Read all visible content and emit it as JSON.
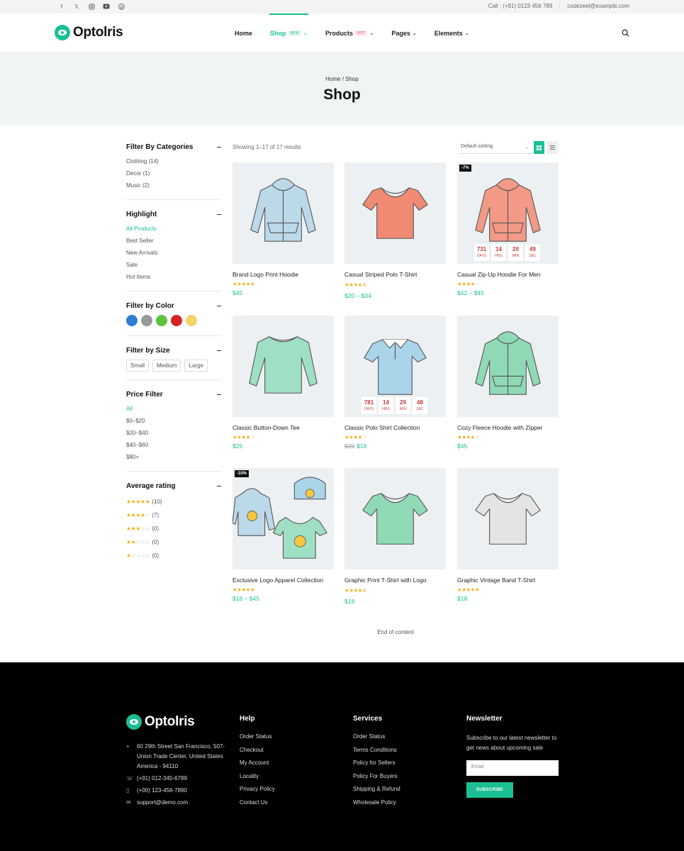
{
  "topbar": {
    "social_icons": [
      "facebook-icon",
      "x-icon",
      "instagram-icon",
      "youtube-icon",
      "pinterest-icon"
    ],
    "phone": "Call : (+91) 0123 456 789",
    "email": "codezeel@example.com"
  },
  "header": {
    "logo": "Optolris",
    "nav": [
      {
        "label": "Home"
      },
      {
        "label": "Shop",
        "badge": "NEW"
      },
      {
        "label": "Products",
        "badge": "HOT"
      },
      {
        "label": "Pages"
      },
      {
        "label": "Elements"
      }
    ]
  },
  "page_head": {
    "breadcrumb": "Home / Shop",
    "title": "Shop"
  },
  "sidebar": {
    "categories": {
      "title": "Filter By Categories",
      "items": [
        "Clothing (14)",
        "Decor (1)",
        "Music (2)"
      ]
    },
    "highlight": {
      "title": "Highlight",
      "items": [
        "All Products",
        "Best Seller",
        "New Arrivals",
        "Sale",
        "Hot Items"
      ]
    },
    "color": {
      "title": "Filter by Color",
      "swatches": [
        "#2d7dd2",
        "#999999",
        "#5cc33b",
        "#d62424",
        "#f5d36b"
      ]
    },
    "size": {
      "title": "Filter by Size",
      "items": [
        "Small",
        "Medium",
        "Large"
      ]
    },
    "price": {
      "title": "Price Filter",
      "items": [
        "All",
        "$0–$20",
        "$20–$40",
        "$40–$60",
        "$80+"
      ]
    },
    "rating": {
      "title": "Average rating",
      "rows": [
        {
          "stars": 5,
          "count": "(10)"
        },
        {
          "stars": 4,
          "count": "(7)"
        },
        {
          "stars": 3,
          "count": "(0)"
        },
        {
          "stars": 2,
          "count": "(0)"
        },
        {
          "stars": 1,
          "count": "(0)"
        }
      ]
    }
  },
  "toolbar": {
    "results": "Showing 1–17 of 17 results",
    "sort": "Default sorting"
  },
  "products": [
    {
      "name": "Brand Logo Print Hoodie",
      "rating": 5,
      "price": "$45",
      "image": "hoodie",
      "color": "#bcd9ea"
    },
    {
      "name": "Casual Striped Polo T-Shirt",
      "rating": 4.5,
      "price": "$20 – $34",
      "image": "tshirt",
      "color": "#f08a72"
    },
    {
      "name": "Casual Zip-Up Hoodie For Men",
      "rating": 4,
      "price": "$42 – $45",
      "image": "hoodie",
      "color": "#f29a86",
      "badge": "-7%",
      "countdown": [
        {
          "n": "731",
          "u": "DAYS"
        },
        {
          "n": "14",
          "u": "HRS"
        },
        {
          "n": "29",
          "u": "MIN"
        },
        {
          "n": "49",
          "u": "SEC"
        }
      ]
    },
    {
      "name": "Classic Button-Down Tee",
      "rating": 4,
      "price": "$25",
      "image": "longsleeve",
      "color": "#9fe0c4"
    },
    {
      "name": "Classic Polo Shirt Collection",
      "rating": 4,
      "old_price": "$20",
      "price": "$18",
      "image": "polo",
      "color": "#a9d4ea",
      "countdown": [
        {
          "n": "781",
          "u": "DAYS"
        },
        {
          "n": "14",
          "u": "HRS"
        },
        {
          "n": "29",
          "u": "MIN"
        },
        {
          "n": "48",
          "u": "SEC"
        }
      ]
    },
    {
      "name": "Cozy Fleece Hoodie with Zipper",
      "rating": 4,
      "price": "$45",
      "image": "hoodie",
      "color": "#8fdab5"
    },
    {
      "name": "Exclusive Logo Apparel Collection",
      "rating": 5,
      "price": "$18 – $45",
      "image": "collection",
      "color": "#bcd9ea",
      "badge": "-10%"
    },
    {
      "name": "Graphic Print T-Shirt with Logo",
      "rating": 4.5,
      "price": "$18",
      "image": "tshirt",
      "color": "#8fdab5"
    },
    {
      "name": "Graphic Vintage Band T-Shirt",
      "rating": 5,
      "price": "$18",
      "image": "tshirt",
      "color": "#e4e4e4"
    }
  ],
  "end_note": "End of content",
  "footer": {
    "logo": "Optolris",
    "address": "60 29th Street San Francisco, 507-Union Trade Center, United States America - 94110",
    "phone1": "(+91) 012-345-6789",
    "phone2": "(+00) 123-456-7890",
    "email": "support@demo.com",
    "help": {
      "title": "Help",
      "links": [
        "Order Status",
        "Checkout",
        "My Account",
        "Locality",
        "Privacy Policy",
        "Contact Us"
      ]
    },
    "services": {
      "title": "Services",
      "links": [
        "Order Status",
        "Terms Conditions",
        "Policy for Sellers",
        "Policy For Buyers",
        "Shipping & Refund",
        "Wholesale Policy"
      ]
    },
    "newsletter": {
      "title": "Newsletter",
      "text": "Subscribe to our latest newsletter to get news about upcoming sale",
      "placeholder": "Email",
      "button": "SUBSCRIBE"
    }
  }
}
